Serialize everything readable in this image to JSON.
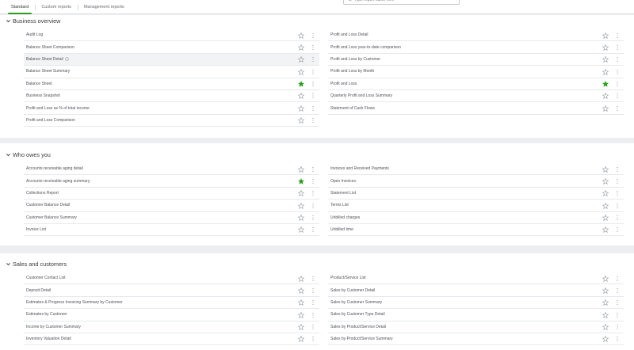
{
  "tabs": [
    {
      "label": "Standard"
    },
    {
      "label": "Custom reports"
    },
    {
      "label": "Management reports"
    }
  ],
  "search": {
    "placeholder": "Type report name here"
  },
  "colors": {
    "accent": "#2ca01c",
    "star_outline": "#8d9096",
    "kebab": "#8d9096"
  },
  "sections": [
    {
      "title": "Business overview",
      "left": [
        {
          "label": "Audit Log",
          "favorite": false
        },
        {
          "label": "Balance Sheet Comparison",
          "favorite": false
        },
        {
          "label": "Balance Sheet Detail",
          "favorite": false,
          "info_icon": "info-circle-icon"
        },
        {
          "label": "Balance Sheet Summary",
          "favorite": false
        },
        {
          "label": "Balance Sheet",
          "favorite": true
        },
        {
          "label": "Business Snapshot",
          "favorite": false
        },
        {
          "label": "Profit and Loss as % of total income",
          "favorite": false
        },
        {
          "label": "Profit and Loss Comparison",
          "favorite": false
        }
      ],
      "right": [
        {
          "label": "Profit and Loss Detail",
          "favorite": false
        },
        {
          "label": "Profit and Loss year-to-date comparison",
          "favorite": false
        },
        {
          "label": "Profit and Loss by Customer",
          "favorite": false
        },
        {
          "label": "Profit and Loss by Month",
          "favorite": false
        },
        {
          "label": "Profit and Loss",
          "favorite": true
        },
        {
          "label": "Quarterly Profit and Loss Summary",
          "favorite": false
        },
        {
          "label": "Statement of Cash Flows",
          "favorite": false
        }
      ]
    },
    {
      "title": "Who owes you",
      "left": [
        {
          "label": "Accounts receivable aging detail",
          "favorite": false
        },
        {
          "label": "Accounts receivable aging summary",
          "favorite": true
        },
        {
          "label": "Collections Report",
          "favorite": false
        },
        {
          "label": "Customer Balance Detail",
          "favorite": false
        },
        {
          "label": "Customer Balance Summary",
          "favorite": false
        },
        {
          "label": "Invoice List",
          "favorite": false
        }
      ],
      "right": [
        {
          "label": "Invoices and Received Payments",
          "favorite": false
        },
        {
          "label": "Open Invoices",
          "favorite": false
        },
        {
          "label": "Statement List",
          "favorite": false
        },
        {
          "label": "Terms List",
          "favorite": false
        },
        {
          "label": "Unbilled charges",
          "favorite": false
        },
        {
          "label": "Unbilled time",
          "favorite": false
        }
      ]
    },
    {
      "title": "Sales and customers",
      "left": [
        {
          "label": "Customer Contact List",
          "favorite": false
        },
        {
          "label": "Deposit Detail",
          "favorite": false
        },
        {
          "label": "Estimates & Progress Invoicing Summary by Customer",
          "favorite": false
        },
        {
          "label": "Estimates by Customer",
          "favorite": false
        },
        {
          "label": "Income by Customer Summary",
          "favorite": false
        },
        {
          "label": "Inventory Valuation Detail",
          "favorite": false
        }
      ],
      "right": [
        {
          "label": "Product/Service List",
          "favorite": false
        },
        {
          "label": "Sales by Customer Detail",
          "favorite": false
        },
        {
          "label": "Sales by Customer Summary",
          "favorite": false
        },
        {
          "label": "Sales by Customer Type Detail",
          "favorite": false
        },
        {
          "label": "Sales by Product/Service Detail",
          "favorite": false
        },
        {
          "label": "Sales by Product/Service Summary",
          "favorite": false
        }
      ]
    }
  ]
}
